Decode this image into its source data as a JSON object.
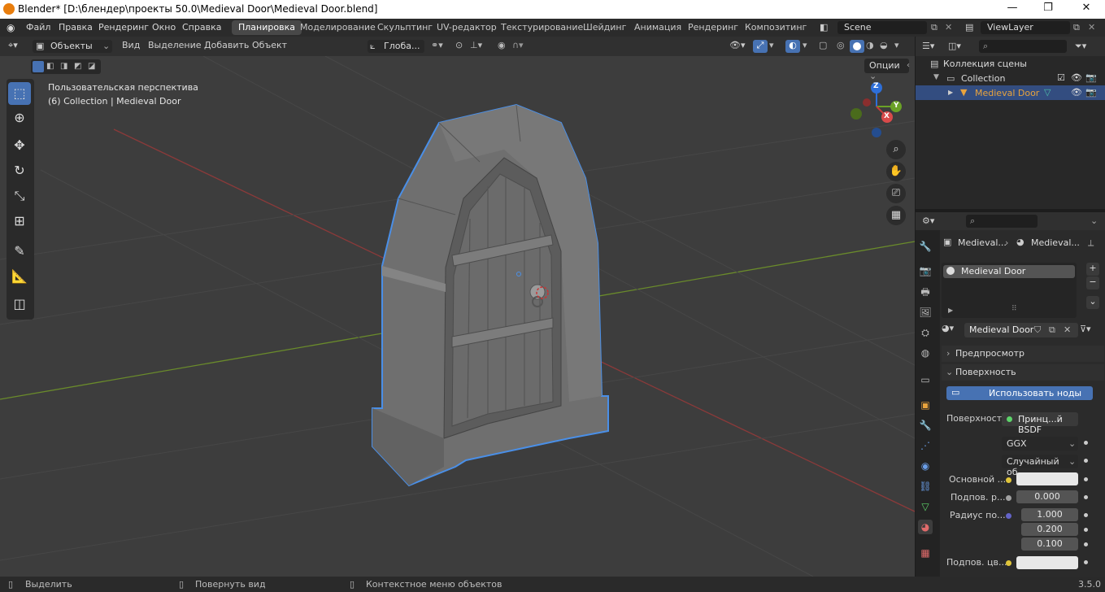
{
  "window": {
    "title": "Blender* [D:\\блендер\\проекты 50.0\\Medieval Door\\Medieval Door.blend]"
  },
  "menu": [
    "Файл",
    "Правка",
    "Рендеринг",
    "Окно",
    "Справка"
  ],
  "workspaces": [
    "Планировка",
    "Моделирование",
    "Скульптинг",
    "UV-редактор",
    "Текстурирование",
    "Шейдинг",
    "Анимация",
    "Рендеринг",
    "Композитинг"
  ],
  "scene": {
    "name": "Scene",
    "view_layer": "ViewLayer"
  },
  "viewport_header": {
    "mode": "Объекты",
    "menus": [
      "Вид",
      "Выделение",
      "Добавить",
      "Объект"
    ],
    "orientation": "Глоба...",
    "options": "Опции"
  },
  "viewport": {
    "perspective_label": "Пользовательская перспектива",
    "collection_label": "(6) Collection | Medieval Door"
  },
  "gizmo": {
    "z": "Z",
    "y": "Y",
    "x": "X"
  },
  "outliner": {
    "root": "Коллекция сцены",
    "collection": "Collection",
    "object": "Medieval Door"
  },
  "properties": {
    "breadcrumb_object": "Medieval...",
    "breadcrumb_material": "Medieval...",
    "slot_name": "Medieval Door",
    "material_name": "Medieval Door",
    "panel_preview": "Предпросмотр",
    "panel_surface": "Поверхность",
    "use_nodes_button": "Использовать ноды",
    "surface_label": "Поверхность",
    "surface_value": "Принц...й BSDF",
    "distribution": "GGX",
    "subsurface_method": "Случайный об...",
    "base_color_label": "Основной ...",
    "subsurface_label": "Подпов. р...",
    "subsurface_value": "0.000",
    "radius_label": "Радиус по...",
    "radius_values": [
      "1.000",
      "0.200",
      "0.100"
    ],
    "subsurface_color_label": "Подпов. цв..."
  },
  "statusbar": {
    "select": "Выделить",
    "rotate": "Повернуть вид",
    "context": "Контекстное меню объектов",
    "version": "3.5.0"
  },
  "colors": {
    "accent": "#4772b3",
    "selection_outline": "#4a8fe7",
    "viewport_bg": "#3d3d3d",
    "object_orange": "#e8a33d"
  }
}
